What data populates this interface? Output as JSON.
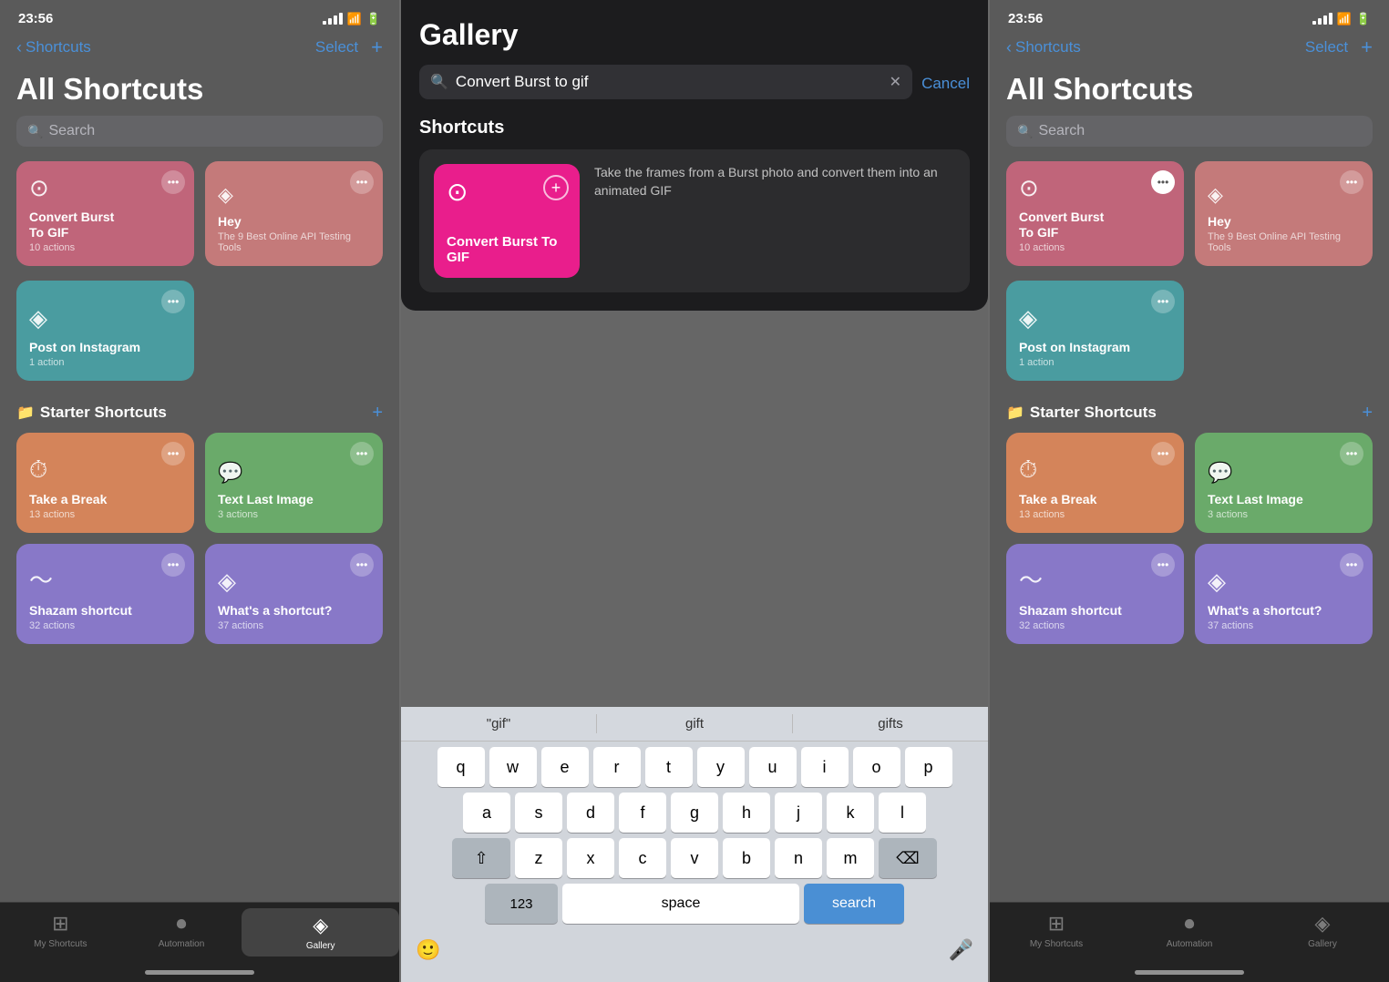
{
  "left_phone": {
    "status": {
      "time": "23:56",
      "location": true
    },
    "nav": {
      "back_label": "Shortcuts",
      "select_label": "Select",
      "plus_label": "+"
    },
    "page_title": "All Shortcuts",
    "search_placeholder": "Search",
    "shortcuts": [
      {
        "id": "convert-burst",
        "title": "Convert Burst\nTo GIF",
        "subtitle": "10 actions",
        "color": "pink-card",
        "icon": "⊙"
      },
      {
        "id": "hey",
        "title": "Hey",
        "subtitle": "The 9 Best Online API Testing Tools",
        "color": "salmon-card",
        "icon": "◈"
      }
    ],
    "single_shortcuts": [
      {
        "id": "instagram",
        "title": "Post on Instagram",
        "subtitle": "1 action",
        "color": "teal-card",
        "icon": "◈"
      }
    ],
    "section_title": "Starter Shortcuts",
    "starter_shortcuts": [
      {
        "id": "take-break",
        "title": "Take a Break",
        "subtitle": "13 actions",
        "color": "orange-card",
        "icon": "⏱"
      },
      {
        "id": "text-last",
        "title": "Text Last Image",
        "subtitle": "3 actions",
        "color": "green-card",
        "icon": "+"
      },
      {
        "id": "shazam",
        "title": "Shazam shortcut",
        "subtitle": "32 actions",
        "color": "waveform-card",
        "icon": "♦"
      },
      {
        "id": "whats-shortcut",
        "title": "What's a shortcut?",
        "subtitle": "37 actions",
        "color": "purple-card",
        "icon": "◈"
      }
    ],
    "tabs": [
      {
        "id": "my-shortcuts",
        "label": "My Shortcuts",
        "icon": "⊞",
        "active": false
      },
      {
        "id": "automation",
        "label": "Automation",
        "icon": "✓",
        "active": false
      },
      {
        "id": "gallery",
        "label": "Gallery",
        "icon": "◈",
        "active": true
      }
    ]
  },
  "center_panel": {
    "gallery_title": "Gallery",
    "search_value": "Convert Burst to gif",
    "cancel_label": "Cancel",
    "section_title": "Shortcuts",
    "result": {
      "card_title": "Convert Burst\nTo GIF",
      "description": "Take the frames from a Burst photo and convert them into an animated GIF"
    },
    "keyboard": {
      "autocomplete": [
        "\"gif\"",
        "gift",
        "gifts"
      ],
      "rows": [
        [
          "q",
          "w",
          "e",
          "r",
          "t",
          "y",
          "u",
          "i",
          "o",
          "p"
        ],
        [
          "a",
          "s",
          "d",
          "f",
          "g",
          "h",
          "j",
          "k",
          "l"
        ],
        [
          "z",
          "x",
          "c",
          "v",
          "b",
          "n",
          "m"
        ]
      ],
      "bottom": {
        "numbers_label": "123",
        "space_label": "space",
        "search_label": "search"
      }
    }
  },
  "right_phone": {
    "status": {
      "time": "23:56",
      "location": true
    },
    "nav": {
      "back_label": "Shortcuts",
      "select_label": "Select",
      "plus_label": "+"
    },
    "page_title": "All Shortcuts",
    "search_placeholder": "Search",
    "shortcuts": [
      {
        "id": "convert-burst",
        "title": "Convert Burst\nTo GIF",
        "subtitle": "10 actions",
        "color": "pink-card",
        "icon": "⊙",
        "menu_highlighted": true
      },
      {
        "id": "hey",
        "title": "Hey",
        "subtitle": "The 9 Best Online API Testing Tools",
        "color": "salmon-card",
        "icon": "◈"
      }
    ],
    "single_shortcuts": [
      {
        "id": "instagram",
        "title": "Post on Instagram",
        "subtitle": "1 action",
        "color": "teal-card",
        "icon": "◈"
      }
    ],
    "section_title": "Starter Shortcuts",
    "starter_shortcuts": [
      {
        "id": "take-break",
        "title": "Take a Break",
        "subtitle": "13 actions",
        "color": "orange-card",
        "icon": "⏱"
      },
      {
        "id": "text-last",
        "title": "Text Last Image",
        "subtitle": "3 actions",
        "color": "green-card",
        "icon": "+"
      },
      {
        "id": "shazam",
        "title": "Shazam shortcut",
        "subtitle": "32 actions",
        "color": "waveform-card",
        "icon": "♦"
      },
      {
        "id": "whats-shortcut",
        "title": "What's a shortcut?",
        "subtitle": "37 actions",
        "color": "purple-card",
        "icon": "◈"
      }
    ],
    "tabs": [
      {
        "id": "my-shortcuts",
        "label": "My Shortcuts",
        "icon": "⊞",
        "active": false
      },
      {
        "id": "automation",
        "label": "Automation",
        "icon": "✓",
        "active": false
      },
      {
        "id": "gallery",
        "label": "Gallery",
        "icon": "◈",
        "active": false
      }
    ]
  }
}
